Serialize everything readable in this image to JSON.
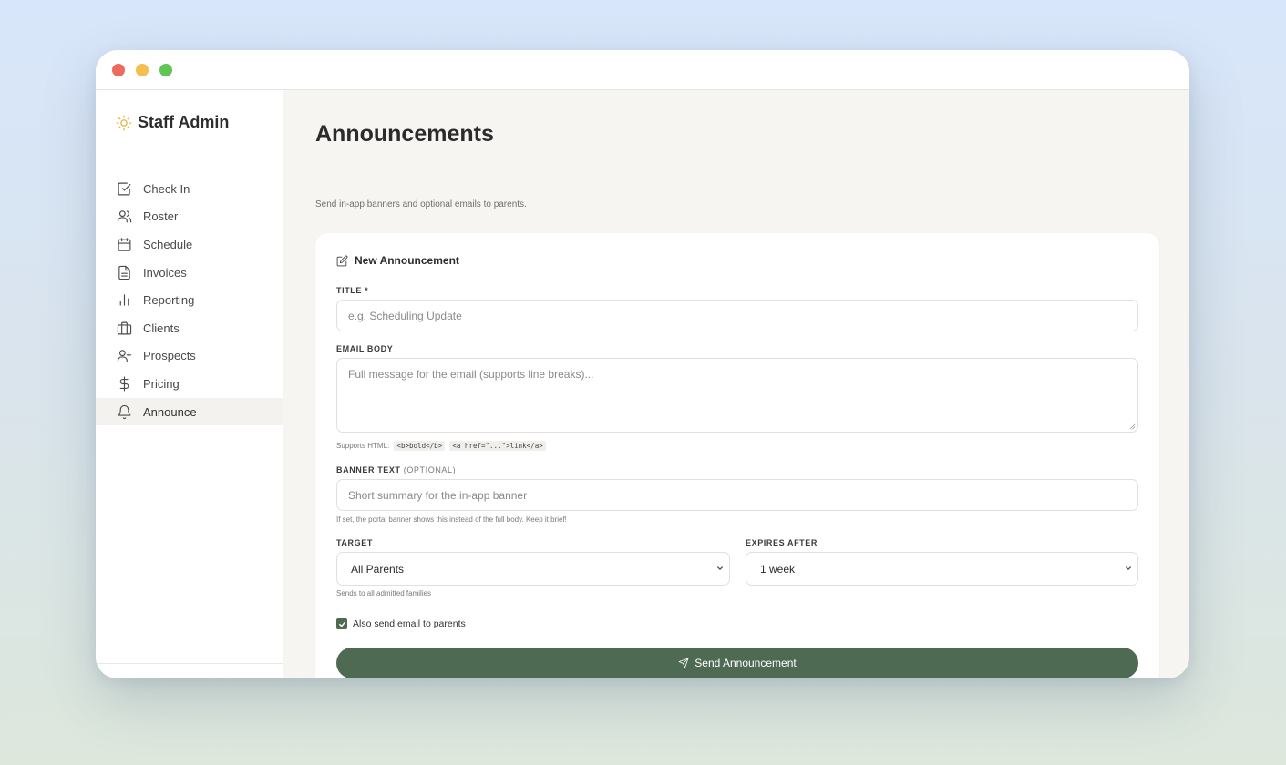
{
  "app": {
    "brand_name": "Staff Admin",
    "accent": "#4e6a52",
    "brand_icon": "sun-icon"
  },
  "sidebar": {
    "items": [
      {
        "label": "Check In",
        "icon": "check-square-icon"
      },
      {
        "label": "Roster",
        "icon": "users-icon"
      },
      {
        "label": "Schedule",
        "icon": "calendar-icon"
      },
      {
        "label": "Invoices",
        "icon": "file-text-icon"
      },
      {
        "label": "Reporting",
        "icon": "bar-chart-icon"
      },
      {
        "label": "Clients",
        "icon": "briefcase-icon"
      },
      {
        "label": "Prospects",
        "icon": "user-plus-icon"
      },
      {
        "label": "Pricing",
        "icon": "dollar-icon"
      },
      {
        "label": "Announce",
        "icon": "bell-icon",
        "active": true
      }
    ]
  },
  "page": {
    "title": "Announcements",
    "subtitle": "Send in-app banners and optional emails to parents."
  },
  "form": {
    "heading": "New Announcement",
    "title_label": "TITLE *",
    "title_placeholder": "e.g. Scheduling Update",
    "email_body_label": "EMAIL BODY",
    "email_body_placeholder": "Full message for the email (supports line breaks)...",
    "html_hint_prefix": "Supports HTML:",
    "html_hint_code1": "<b>bold</b>",
    "html_hint_code2": "<a href=\"...\">link</a>",
    "banner_label": "BANNER TEXT",
    "banner_label_optional": "(OPTIONAL)",
    "banner_placeholder": "Short summary for the in-app banner",
    "banner_hint": "If set, the portal banner shows this instead of the full body. Keep it brief!",
    "target_label": "TARGET",
    "target_value": "All Parents",
    "target_hint": "Sends to all admitted families",
    "expires_label": "EXPIRES AFTER",
    "expires_value": "1 week",
    "also_email_label": "Also send email to parents",
    "also_email_checked": true,
    "send_button": "Send Announcement"
  }
}
